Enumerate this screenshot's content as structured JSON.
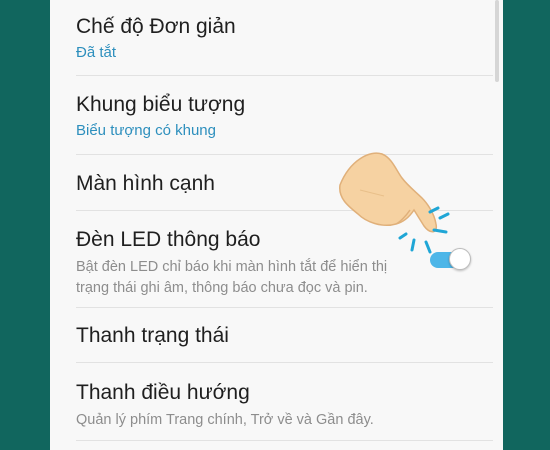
{
  "settings": {
    "items": [
      {
        "title": "Chế độ Đơn giản",
        "subtitle": "Đã tắt"
      },
      {
        "title": "Khung biểu tượng",
        "subtitle": "Biểu tượng có khung"
      },
      {
        "title": "Màn hình cạnh"
      },
      {
        "title": "Đèn LED thông báo",
        "description": "Bật đèn LED chỉ báo khi màn hình tắt để hiển thị trạng thái ghi âm, thông báo chưa đọc và pin.",
        "toggle_on": true
      },
      {
        "title": "Thanh trạng thái"
      },
      {
        "title": "Thanh điều hướng",
        "description": "Quản lý phím Trang chính, Trở về và Gần đây."
      }
    ]
  },
  "colors": {
    "background": "#11665e",
    "panel": "#f8f8f8",
    "accent": "#2d8fbd",
    "toggle_track": "#4db6e8"
  },
  "icons": {
    "tap_hand": "pointing-hand-icon",
    "tap_indicator": "tap-ripple-icon"
  }
}
